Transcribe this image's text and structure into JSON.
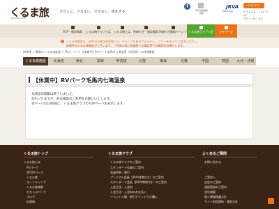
{
  "header": {
    "logo": "くるま旅",
    "logo_sub": "KURUMA TABI",
    "tagline": "さらくに、さまよに、さがるに、旅をする",
    "facebook": "f",
    "register_label": "車中泊施設登録者",
    "jrva": "JRVA",
    "jrva_sub": "日本RV協会",
    "login": "ログイン",
    "greeting_1": "ゲストさん、こんにちは！",
    "greeting_2": "ログインはこちら"
  },
  "nav": {
    "items": [
      {
        "label": "TOP・施設検索"
      },
      {
        "label": "くるま旅クラブとは"
      },
      {
        "label": "くるま旅とは"
      },
      {
        "label": "特典付き・施設検索"
      },
      {
        "label": "特典付き無料イベント"
      },
      {
        "label": "くるま旅クラブ入会"
      },
      {
        "label": "マイページ"
      }
    ]
  },
  "notice": {
    "line1": "くるま旅施設は、車中泊可能な駐車場です。キャンプ行為はできません。マナーを守ってご利用ください。",
    "line2": "休業中のくるま旅施設がございます。ご利用の前に各施設へお電話等での確認をお願いします。"
  },
  "breadcrumb": "HOME > 関東のくるま旅施設 > RVパーク > 【休業中】RVパーク毛馬内七滝温泉（秋田県）の詳細情報",
  "regions": {
    "items": [
      "くるま旅施設",
      "北海道",
      "東北",
      "関東",
      "甲信越",
      "北陸",
      "東海",
      "近畿",
      "中国",
      "四国",
      "九州・沖縄"
    ]
  },
  "content": {
    "title": "【休業中】RVパーク毛馬内七滝温泉",
    "body_1": "本施設の掲載は終了しました。",
    "body_2": "恐れいりますが、他の施設のご利用をお願いいたします。",
    "body_3": "本ページは10秒後に、くるま旅クラブのTOPページを表示します。"
  },
  "footer": {
    "col1_head": "くるま旅トップ",
    "col1_sub": "くるま旅とは",
    "col1_links": [
      "RVパーク",
      "湯YOUパーク",
      "くるま旅",
      "オートキャンプ",
      "くるま旅体験",
      "とれっぷパーク",
      "ブログ",
      "出版物"
    ],
    "col2_head": "くるま旅クラブ",
    "col2_links": [
      "くるま旅クラブのご案内",
      "スタンダード会員のご案内",
      "会員特典・割引",
      "プレミアム会員（JRVA特典付き）のご案内",
      "スタンダード会員（JRVA特典付き）のご案内",
      "入会方法・入会料",
      "入会方法・入会料のお支払い",
      "イベント入場・割引チケット付き購入"
    ],
    "col3_head": "よくあるご質問",
    "col3_links": [
      "お問い合わせ",
      "ご案内へ",
      "広告のご案内",
      "施設登録のご案内",
      "会社概要",
      "個人情報保護方針",
      "サイト利用規約・運営方針"
    ]
  },
  "colors": {
    "brand_brown": "#3b2416",
    "accent_orange": "#e8751a",
    "accent_green": "#55a531"
  }
}
